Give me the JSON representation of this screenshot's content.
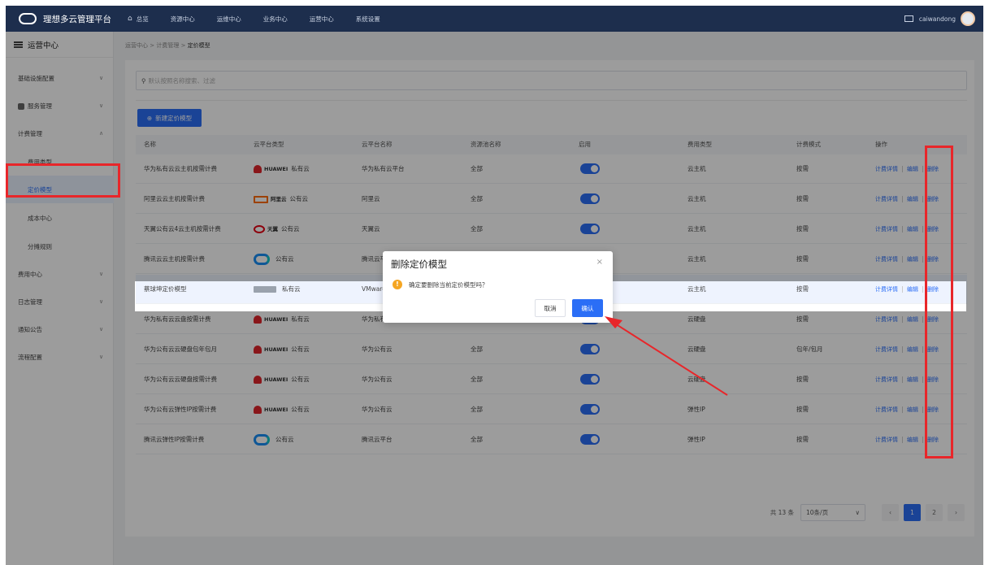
{
  "app": {
    "title": "理想多云管理平台",
    "nav": [
      "总览",
      "资源中心",
      "运维中心",
      "业务中心",
      "运营中心",
      "系统设置"
    ],
    "username": "caiwandong"
  },
  "sidebar": {
    "title": "运营中心",
    "items": [
      {
        "label": "基础设施配置",
        "chev": "∨"
      },
      {
        "label": "服务管理",
        "chev": "∨"
      },
      {
        "label": "计费管理",
        "chev": "∧"
      },
      {
        "label": "费用类型",
        "chev": ""
      },
      {
        "label": "定价模型",
        "chev": ""
      },
      {
        "label": "成本中心",
        "chev": ""
      },
      {
        "label": "分摊规则",
        "chev": ""
      },
      {
        "label": "费用中心",
        "chev": "∨"
      },
      {
        "label": "日志管理",
        "chev": "∨"
      },
      {
        "label": "通知公告",
        "chev": "∨"
      },
      {
        "label": "流程配置",
        "chev": "∨"
      }
    ]
  },
  "breadcrumb": {
    "a": "运营中心",
    "sep": ">",
    "b": "计费管理",
    "c": "定价模型"
  },
  "search": {
    "placeholder": "默认按照名称搜索、过滤"
  },
  "toolbar": {
    "new_label": "新建定价模型"
  },
  "table": {
    "headers": [
      "名称",
      "云平台类型",
      "云平台名称",
      "资源池名称",
      "启用",
      "费用类型",
      "计费模式",
      "操作"
    ],
    "ops": {
      "detail": "计费详情",
      "edit": "编辑",
      "delete": "删除"
    },
    "rows": [
      {
        "name": "华为私有云云主机按需计费",
        "logo": "huawei",
        "brand": "HUAWEI",
        "ptype": "私有云",
        "pname": "华为私有云平台",
        "pool": "全部",
        "enabled": true,
        "fee": "云主机",
        "mode": "按需"
      },
      {
        "name": "阿里云云主机按需计费",
        "logo": "aliyun",
        "brand": "阿里云",
        "ptype": "公有云",
        "pname": "阿里云",
        "pool": "全部",
        "enabled": true,
        "fee": "云主机",
        "mode": "按需"
      },
      {
        "name": "天翼公有云4云主机按需计费",
        "logo": "tianyi",
        "brand": "天翼",
        "ptype": "公有云",
        "pname": "天翼云",
        "pool": "全部",
        "enabled": true,
        "fee": "云主机",
        "mode": "按需"
      },
      {
        "name": "腾讯云云主机按需计费",
        "logo": "tencent",
        "brand": "",
        "ptype": "公有云",
        "pname": "腾讯云平台",
        "pool": "全部",
        "enabled": true,
        "fee": "云主机",
        "mode": "按需"
      },
      {
        "name": "蔡球坤定价模型",
        "logo": "vmware",
        "brand": "",
        "ptype": "私有云",
        "pname": "VMware",
        "pool": "全部",
        "enabled": true,
        "fee": "云主机",
        "mode": "按需"
      },
      {
        "name": "华为私有云云盘按需计费",
        "logo": "huawei",
        "brand": "HUAWEI",
        "ptype": "私有云",
        "pname": "华为私有云平台",
        "pool": "全部",
        "enabled": true,
        "fee": "云硬盘",
        "mode": "按需"
      },
      {
        "name": "华为公有云云硬盘包年包月",
        "logo": "huawei",
        "brand": "HUAWEI",
        "ptype": "公有云",
        "pname": "华为公有云",
        "pool": "全部",
        "enabled": true,
        "fee": "云硬盘",
        "mode": "包年/包月"
      },
      {
        "name": "华为公有云云硬盘按需计费",
        "logo": "huawei",
        "brand": "HUAWEI",
        "ptype": "公有云",
        "pname": "华为公有云",
        "pool": "全部",
        "enabled": true,
        "fee": "云硬盘",
        "mode": "按需"
      },
      {
        "name": "华为公有云弹性IP按需计费",
        "logo": "huawei",
        "brand": "HUAWEI",
        "ptype": "公有云",
        "pname": "华为公有云",
        "pool": "全部",
        "enabled": true,
        "fee": "弹性IP",
        "mode": "按需"
      },
      {
        "name": "腾讯云弹性IP按需计费",
        "logo": "tencent",
        "brand": "",
        "ptype": "公有云",
        "pname": "腾讯云平台",
        "pool": "全部",
        "enabled": true,
        "fee": "弹性IP",
        "mode": "按需"
      }
    ]
  },
  "pagination": {
    "total": "共 13 条",
    "page_size": "10条/页",
    "chev": "∨",
    "prev": "‹",
    "pages": [
      "1",
      "2"
    ],
    "next": "›",
    "current": "1"
  },
  "dialog": {
    "title": "删除定价模型",
    "close": "×",
    "message": "确定要删除当前定价模型吗？",
    "warn_glyph": "!",
    "cancel": "取消",
    "confirm": "确认"
  },
  "colors": {
    "primary": "#2b6ef6",
    "topbar": "#1d2e4d",
    "annotation": "#e8262a",
    "warning": "#f5a623"
  },
  "icons": {
    "home": "⌂",
    "search": "⚲",
    "add": "⊕",
    "menu": "☰"
  }
}
